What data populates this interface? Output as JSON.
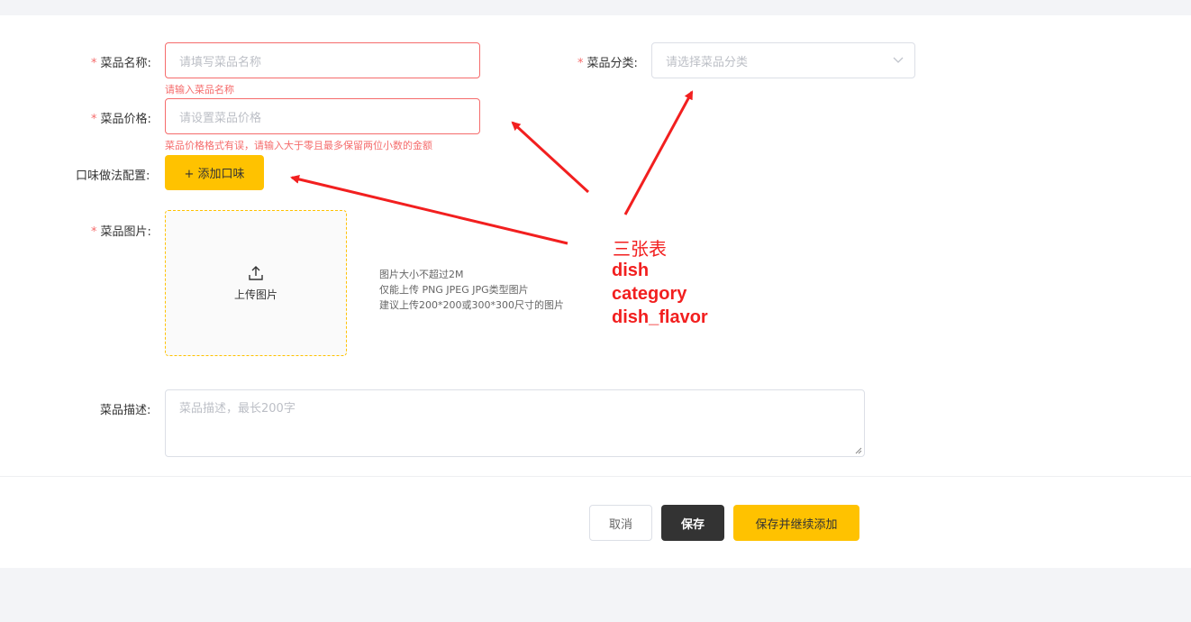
{
  "form": {
    "name": {
      "required_mark": "*",
      "label": "菜品名称:",
      "placeholder": "请填写菜品名称",
      "error": "请输入菜品名称"
    },
    "category": {
      "required_mark": "*",
      "label": "菜品分类:",
      "placeholder": "请选择菜品分类"
    },
    "price": {
      "required_mark": "*",
      "label": "菜品价格:",
      "placeholder": "请设置菜品价格",
      "error": "菜品价格格式有误，请输入大于零且最多保留两位小数的金额"
    },
    "flavor": {
      "label": "口味做法配置:",
      "button": "+ 添加口味"
    },
    "image": {
      "required_mark": "*",
      "label": "菜品图片:",
      "upload_label": "上传图片",
      "hints": [
        "图片大小不超过2M",
        "仅能上传 PNG JPEG JPG类型图片",
        "建议上传200*200或300*300尺寸的图片"
      ]
    },
    "description": {
      "label": "菜品描述:",
      "placeholder": "菜品描述，最长200字"
    }
  },
  "footer": {
    "cancel": "取消",
    "save": "保存",
    "save_and_add": "保存并继续添加"
  },
  "annotation": {
    "title": "三张表",
    "lines": [
      "dish",
      "category",
      "dish_flavor"
    ],
    "color": "#f21f1f"
  },
  "colors": {
    "accent": "#ffc200",
    "error": "#f56c6c",
    "dark_button": "#333333"
  },
  "icons": {
    "upload": "upload-icon",
    "select_arrow": "chevron-down-icon"
  }
}
